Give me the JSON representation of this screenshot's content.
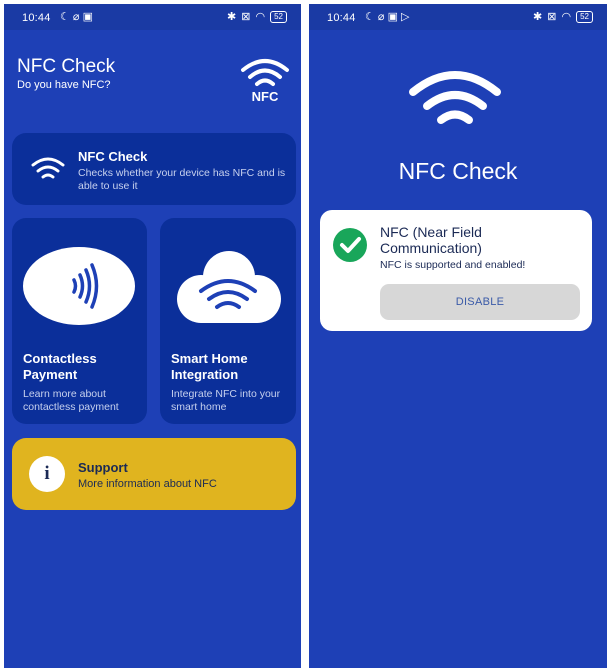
{
  "colors": {
    "background": "#1e40b6",
    "card": "#0b2f9a",
    "support_card": "#e0b41f",
    "success": "#19a65a",
    "disable_button": "#d7d7d7"
  },
  "left_screen": {
    "status_bar": {
      "time": "10:44",
      "battery": "52"
    },
    "header": {
      "title": "NFC Check",
      "subtitle": "Do you have NFC?",
      "logo_text": "NFC"
    },
    "cards": {
      "nfc_check": {
        "title": "NFC Check",
        "description": "Checks whether your device has NFC and is able to use it",
        "icon": "wifi-waves-icon"
      },
      "contactless": {
        "title": "Contactless Payment",
        "description": "Learn more about contactless payment",
        "icon": "contactless-icon"
      },
      "smart_home": {
        "title": "Smart Home Integration",
        "description": "Integrate NFC into your smart home",
        "icon": "cloud-wifi-icon"
      },
      "support": {
        "title": "Support",
        "description": "More information about NFC",
        "icon_text": "i"
      }
    }
  },
  "right_screen": {
    "status_bar": {
      "time": "10:44",
      "battery": "52"
    },
    "title": "NFC Check",
    "status_card": {
      "title": "NFC (Near Field Communication)",
      "message": "NFC is supported and enabled!",
      "button": "DISABLE"
    }
  }
}
